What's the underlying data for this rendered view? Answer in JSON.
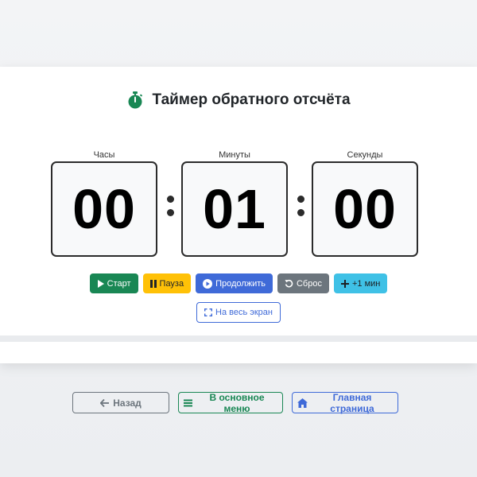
{
  "header": {
    "title": "Таймер обратного отсчёта",
    "icon": "stopwatch-icon",
    "icon_color": "#198754"
  },
  "timer": {
    "hours": {
      "label": "Часы",
      "value": "00"
    },
    "minutes": {
      "label": "Минуты",
      "value": "01"
    },
    "seconds": {
      "label": "Секунды",
      "value": "00"
    }
  },
  "controls": {
    "start_label": "Старт",
    "pause_label": "Пауза",
    "resume_label": "Продолжить",
    "reset_label": "Сброс",
    "add_minute_label": "+1 мин",
    "fullscreen_label": "На весь экран"
  },
  "nav": {
    "back_label": "Назад",
    "menu_label": "В основное меню",
    "home_label": "Главная страница"
  },
  "colors": {
    "success": "#198754",
    "warning": "#ffc107",
    "primary": "#3f6ad8",
    "secondary": "#6c757d",
    "info": "#3fc1e6"
  }
}
